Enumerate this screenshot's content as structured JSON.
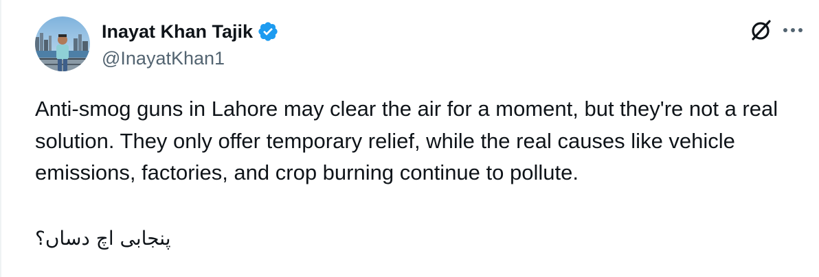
{
  "author": {
    "display_name": "Inayat Khan Tajik",
    "handle": "@InayatKhan1",
    "verified": true
  },
  "icons": {
    "avatar": "profile-photo",
    "verified": "verified-badge-icon",
    "grok": "grok-icon",
    "more": "more-icon"
  },
  "colors": {
    "verified": "#1d9bf0",
    "text": "#0f1419",
    "secondary": "#536471"
  },
  "tweet": {
    "text": "Anti-smog guns in Lahore may clear the air for a moment, but they're not a real solution. They only offer temporary relief, while the real causes like vehicle emissions, factories, and crop burning continue to pollute.",
    "urdu_line": "پنجابی اچ دساں؟"
  }
}
